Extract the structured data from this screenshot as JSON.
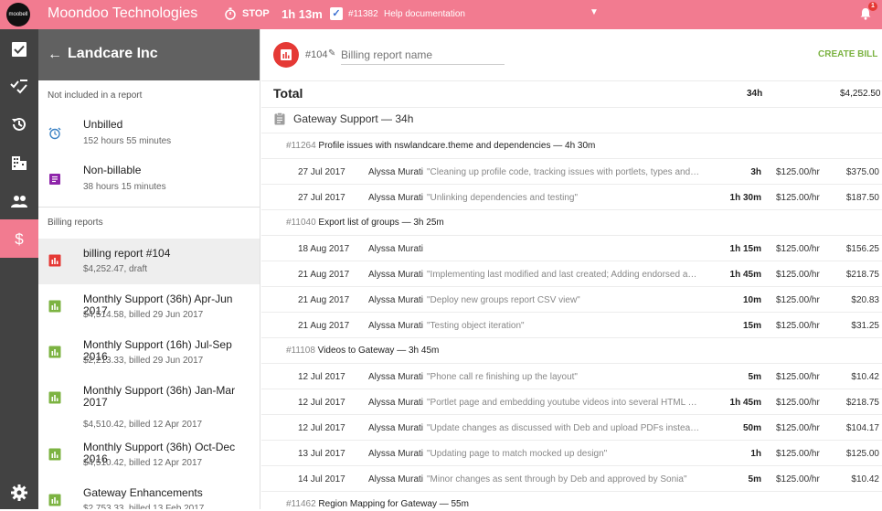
{
  "topbar": {
    "logo_text": "moobell",
    "company": "Moondoo Technologies",
    "stop_label": "STOP",
    "timer": "1h 13m",
    "task_id": "#11382",
    "task_name": "Help documentation",
    "notification_count": "1"
  },
  "rail": {
    "icons": [
      "tasks-icon",
      "checklist-icon",
      "history-icon",
      "building-icon",
      "people-icon",
      "dollar-icon",
      "settings-icon"
    ],
    "active": "dollar-icon"
  },
  "panel": {
    "back_label": "←",
    "title": "Landcare Inc",
    "section_not_included": "Not included in a report",
    "unbilled": {
      "title": "Unbilled",
      "sub": "152 hours 55 minutes"
    },
    "nonbillable": {
      "title": "Non-billable",
      "sub": "38 hours 15 minutes"
    },
    "section_reports": "Billing reports",
    "reports": [
      {
        "title": "billing report #104",
        "sub": "$4,252.47, draft"
      },
      {
        "title": "Monthly Support (36h) Apr-Jun 2017",
        "sub": "$4,514.58, billed 29 Jun 2017"
      },
      {
        "title": "Monthly Support (16h) Jul-Sep 2016",
        "sub": "$2,213.33, billed 29 Jun 2017"
      },
      {
        "title": "Monthly Support (36h) Jan-Mar 2017",
        "sub": "$4,510.42, billed 12 Apr 2017"
      },
      {
        "title": "Monthly Support (36h) Oct-Dec 2016",
        "sub": "$4,510.42, billed 12 Apr 2017"
      },
      {
        "title": "Gateway Enhancements",
        "sub": "$2,753.33, billed 13 Feb 2017"
      }
    ]
  },
  "main": {
    "report_id": "#104",
    "name_placeholder": "Billing report name",
    "create_bill": "CREATE BILL",
    "total_label": "Total",
    "total_hours": "34h",
    "total_amount": "$4,252.50",
    "project_label": "Gateway Support — 34h",
    "groups": [
      {
        "id": "#11264",
        "title": "Profile issues with nswlandcare.theme and dependencies — 4h 30m",
        "entries": [
          {
            "date": "27 Jul 2017",
            "person": "Alyssa Murati",
            "note": "\"Cleaning up profile code, tracking issues with portlets, types and in...",
            "hours": "3h",
            "rate": "$125.00/hr",
            "amount": "$375.00"
          },
          {
            "date": "27 Jul 2017",
            "person": "Alyssa Murati",
            "note": "\"Unlinking dependencies and testing\"",
            "hours": "1h 30m",
            "rate": "$125.00/hr",
            "amount": "$187.50"
          }
        ]
      },
      {
        "id": "#11040",
        "title": "Export list of groups — 3h 25m",
        "entries": [
          {
            "date": "18 Aug 2017",
            "person": "Alyssa Murati",
            "note": "",
            "hours": "1h 15m",
            "rate": "$125.00/hr",
            "amount": "$156.25"
          },
          {
            "date": "21 Aug 2017",
            "person": "Alyssa Murati",
            "note": "\"Implementing last modified and last created; Adding endorsed and ...",
            "hours": "1h 45m",
            "rate": "$125.00/hr",
            "amount": "$218.75"
          },
          {
            "date": "21 Aug 2017",
            "person": "Alyssa Murati",
            "note": "\"Deploy new groups report CSV view\"",
            "hours": "10m",
            "rate": "$125.00/hr",
            "amount": "$20.83"
          },
          {
            "date": "21 Aug 2017",
            "person": "Alyssa Murati",
            "note": "\"Testing object iteration\"",
            "hours": "15m",
            "rate": "$125.00/hr",
            "amount": "$31.25"
          }
        ]
      },
      {
        "id": "#11108",
        "title": "Videos to Gateway — 3h 45m",
        "entries": [
          {
            "date": "12 Jul 2017",
            "person": "Alyssa Murati",
            "note": "\"Phone call re finishing up the layout\"",
            "hours": "5m",
            "rate": "$125.00/hr",
            "amount": "$10.42"
          },
          {
            "date": "12 Jul 2017",
            "person": "Alyssa Murati",
            "note": "\"Portlet page and embedding youtube videos into several HTML port...",
            "hours": "1h 45m",
            "rate": "$125.00/hr",
            "amount": "$218.75"
          },
          {
            "date": "12 Jul 2017",
            "person": "Alyssa Murati",
            "note": "\"Update changes as discussed with Deb and upload PDFs instead of...",
            "hours": "50m",
            "rate": "$125.00/hr",
            "amount": "$104.17"
          },
          {
            "date": "13 Jul 2017",
            "person": "Alyssa Murati",
            "note": "\"Updating page to match mocked up design\"",
            "hours": "1h",
            "rate": "$125.00/hr",
            "amount": "$125.00"
          },
          {
            "date": "14 Jul 2017",
            "person": "Alyssa Murati",
            "note": "\"Minor changes as sent through by Deb and approved by Sonia\"",
            "hours": "5m",
            "rate": "$125.00/hr",
            "amount": "$10.42"
          }
        ]
      },
      {
        "id": "#11462",
        "title": "Region Mapping for Gateway — 55m",
        "entries": []
      }
    ]
  }
}
